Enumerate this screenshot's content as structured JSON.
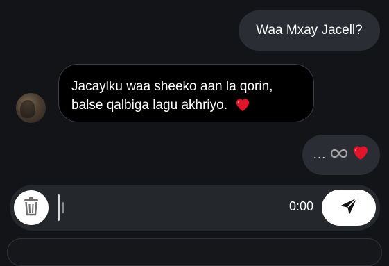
{
  "messages": {
    "outgoing_1": "Waa Mxay Jacell?",
    "incoming_1_line1": "Jacaylku waa sheeko aan la qorin,",
    "incoming_1_line2": "balse qalbiga lagu akhriyo.",
    "outgoing_2_text": "...",
    "heart_icon": "heart-icon",
    "infinity_icon": "infinity-icon"
  },
  "recorder": {
    "timer": "0:00",
    "delete_icon": "trash-icon",
    "send_icon": "send-icon"
  },
  "colors": {
    "background": "#121417",
    "outgoing_bubble": "#2a2d33",
    "incoming_bubble": "#000000",
    "heart": "#e0142a",
    "recorder_bar": "#24272c"
  }
}
